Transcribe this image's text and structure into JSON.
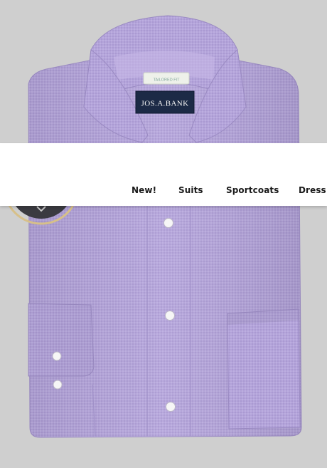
{
  "product": {
    "brand_label": "JOS.A.BANK",
    "fit_tag": "TAILORED FIT"
  },
  "nav": {
    "items": [
      {
        "label": "New!"
      },
      {
        "label": "Suits"
      },
      {
        "label": "Sportcoats"
      },
      {
        "label": "Dress Shirts"
      }
    ]
  },
  "colors": {
    "shirt": "#b3a3da",
    "background": "#cfcfcf",
    "label_navy": "#1c2a46",
    "nav_background": "#ffffff"
  }
}
